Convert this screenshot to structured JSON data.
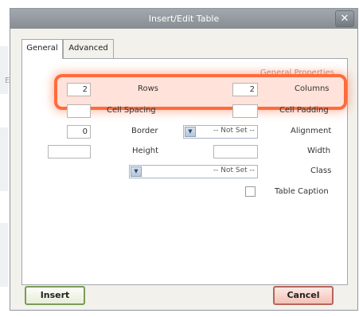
{
  "dialog": {
    "title": "Insert/Edit Table",
    "close_glyph": "✕"
  },
  "tabs": [
    {
      "label": "General",
      "active": true
    },
    {
      "label": "Advanced",
      "active": false
    }
  ],
  "general": {
    "section_title": "General Properties",
    "rows": {
      "label": "Rows",
      "value": "2"
    },
    "columns": {
      "label": "Columns",
      "value": "2"
    },
    "cell_spacing": {
      "label": "Cell Spacing",
      "value": ""
    },
    "cell_padding": {
      "label": "Cell Padding",
      "value": ""
    },
    "border": {
      "label": "Border",
      "value": "0"
    },
    "alignment": {
      "label": "Alignment",
      "selected": "-- Not Set --"
    },
    "height": {
      "label": "Height",
      "value": ""
    },
    "width": {
      "label": "Width",
      "value": ""
    },
    "class": {
      "label": "Class",
      "selected": "-- Not Set --"
    },
    "table_caption": {
      "label": "Table Caption",
      "checked": false
    }
  },
  "buttons": {
    "insert_label": "Insert",
    "cancel_label": "Cancel"
  },
  "colors": {
    "highlight": "#ff6b3d",
    "section_title": "#b98d84",
    "insert_border": "#7c9a5a",
    "cancel_border": "#b8655a"
  },
  "icons": [
    "close-icon",
    "chevron-down-icon",
    "checkbox-icon"
  ]
}
